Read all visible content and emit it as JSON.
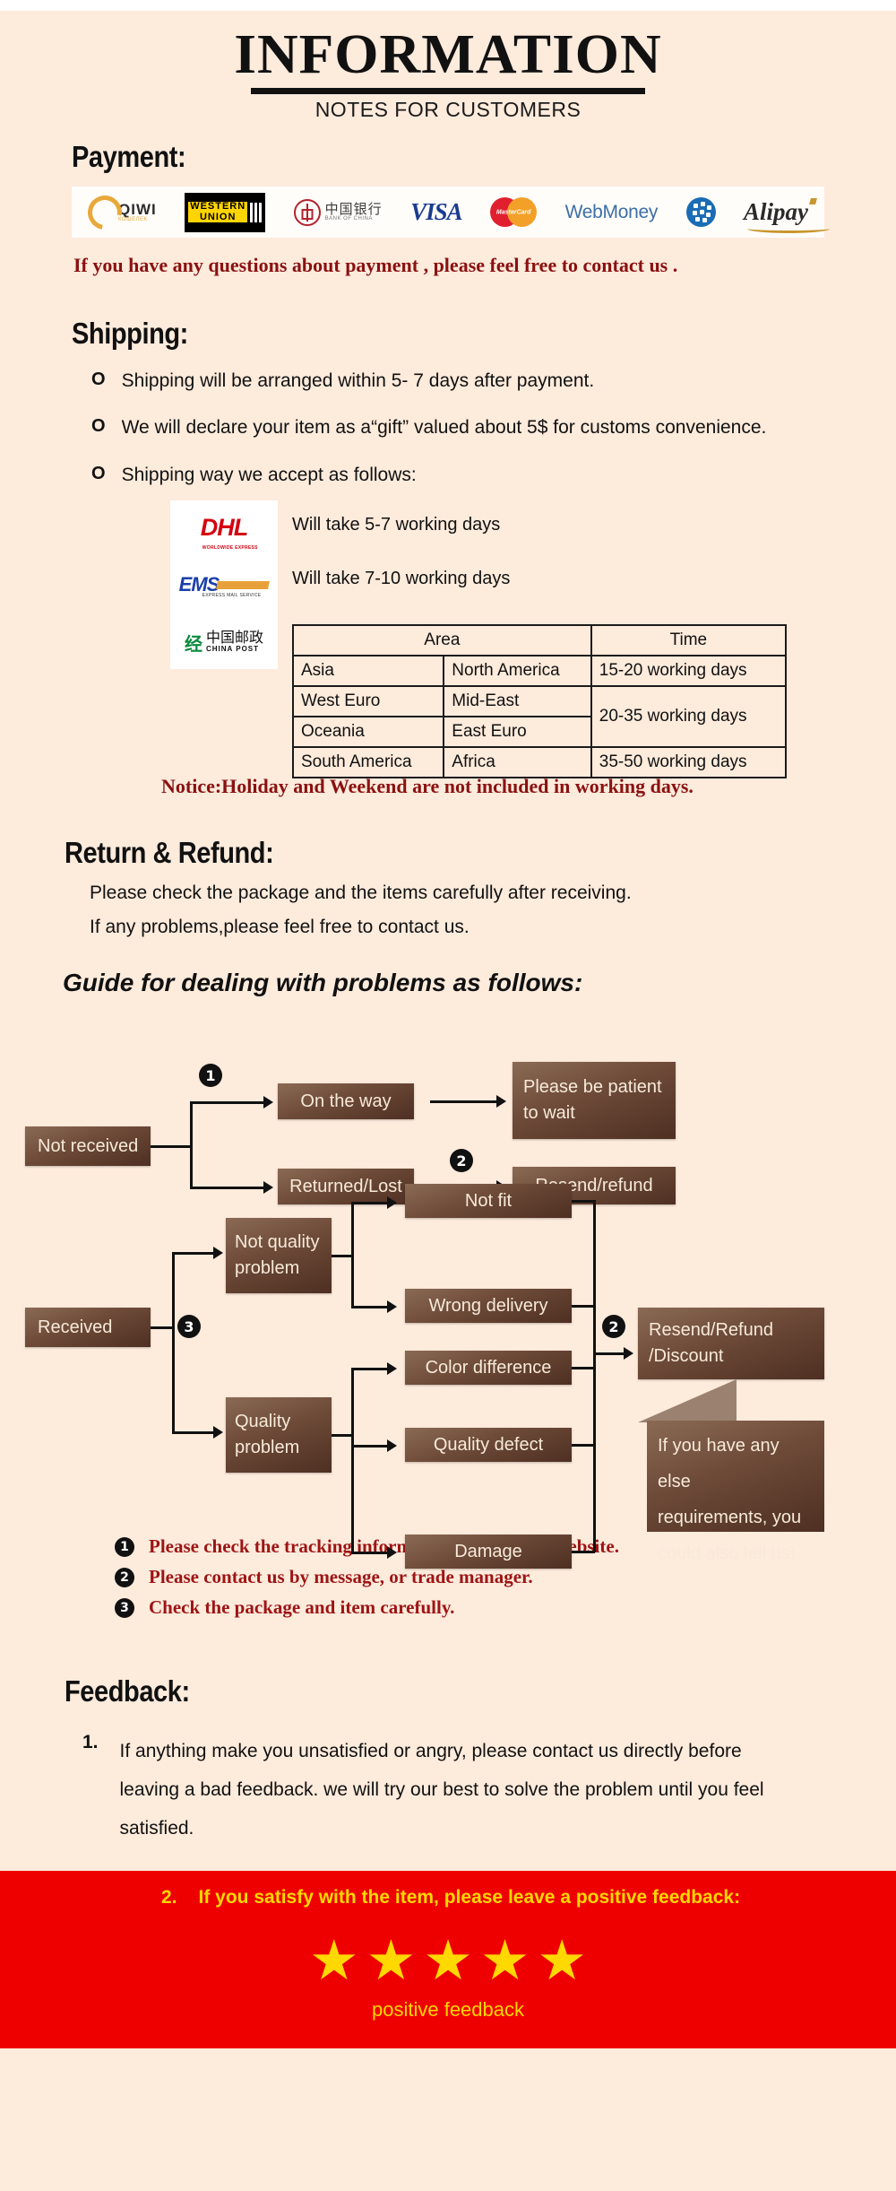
{
  "header": {
    "title": "INFORMATION",
    "subtitle": "NOTES FOR CUSTOMERS"
  },
  "payment": {
    "heading": "Payment:",
    "logos": [
      {
        "name": "qiwi-logo",
        "primary": "QIWI",
        "secondary": "КОШЕЛЕК"
      },
      {
        "name": "western-union-logo",
        "line1": "WESTERN",
        "line2": "UNION"
      },
      {
        "name": "bank-of-china-logo",
        "chinese": "中国银行",
        "roman": "BANK OF CHINA"
      },
      {
        "name": "visa-logo",
        "primary": "VISA"
      },
      {
        "name": "mastercard-logo",
        "primary": "MasterCard"
      },
      {
        "name": "webmoney-logo",
        "primary": "WebMoney"
      },
      {
        "name": "alipay-logo",
        "primary": "Alipay"
      }
    ],
    "note": "If you have any questions about payment , please feel free to contact us ."
  },
  "shipping": {
    "heading": "Shipping:",
    "bullets": [
      "Shipping will be arranged within  5- 7  days after payment.",
      "We will declare your item as a“gift” valued about 5$ for customs convenience.",
      "Shipping way we accept as follows:"
    ],
    "bullet_marker": "O",
    "carriers": [
      {
        "name": "dhl-logo",
        "label": "DHL",
        "sub": "WORLDWIDE EXPRESS",
        "time": "Will take 5-7 working days"
      },
      {
        "name": "ems-logo",
        "label": "EMS",
        "sub": "EXPRESS MAIL SERVICE",
        "time": "Will take 7-10 working days"
      },
      {
        "name": "china-post-logo",
        "chinese": "中国邮政",
        "roman": "CHINA POST",
        "time": ""
      }
    ],
    "table": {
      "headers": [
        "Area",
        "Time"
      ],
      "rows": [
        {
          "area1": "Asia",
          "area2": "North America",
          "time": "15-20 working days",
          "time_rowspan": 1
        },
        {
          "area1": "West Euro",
          "area2": "Mid-East",
          "time": "20-35 working days",
          "time_rowspan": 2
        },
        {
          "area1": "Oceania",
          "area2": "East Euro",
          "time": null,
          "time_rowspan": 0
        },
        {
          "area1": "South America",
          "area2": "Africa",
          "time": "35-50 working days",
          "time_rowspan": 1
        }
      ]
    },
    "notice": "Notice:Holiday and Weekend are not included in working days."
  },
  "returns": {
    "heading": "Return & Refund:",
    "lines": [
      "Please check the package and the items carefully after receiving.",
      "If any problems,please feel free to contact us."
    ],
    "guide_title": "Guide for dealing with problems as follows:"
  },
  "flow": {
    "not_received": "Not received",
    "on_the_way": "On the way",
    "returned_lost": "Returned/Lost",
    "please_be_patient": "Please be patient\nto wait",
    "please_be_patient_l1": "Please be patient",
    "please_be_patient_l2": "to wait",
    "resend_refund": "Resend/refund",
    "received": "Received",
    "not_quality_problem_l1": "Not quality",
    "not_quality_problem_l2": "problem",
    "quality_problem_l1": "Quality",
    "quality_problem_l2": "problem",
    "not_fit": "Not fit",
    "wrong_delivery": "Wrong delivery",
    "color_difference": "Color difference",
    "quality_defect": "Quality defect",
    "damage": "Damage",
    "resend_refund_discount_l1": "Resend/Refund",
    "resend_refund_discount_l2": "/Discount",
    "callout_l1": "If you have any else",
    "callout_l2": "requirements, you",
    "callout_l3": "could also tell us!",
    "badge1": "1",
    "badge2": "2",
    "badge2b": "2",
    "badge3": "3"
  },
  "notes": [
    {
      "num": "1",
      "text": "Please check the tracking information on tracking website."
    },
    {
      "num": "2",
      "text": "Please contact us by message, or trade manager."
    },
    {
      "num": "3",
      "text": "Check the package and item carefully."
    }
  ],
  "feedback": {
    "heading": "Feedback:",
    "item1_index": "1.",
    "item1_text": "If anything make you unsatisfied or angry, please contact us directly before leaving a bad feedback. we will try our best to solve the problem until  you feel satisfied.",
    "item2_index": "2.",
    "item2_text": "If you satisfy with the item, please leave a positive feedback:",
    "stars": "★★★★★",
    "star_glyph": "★",
    "star_count": 5,
    "caption": "positive feedback"
  },
  "colors": {
    "background": "#fdebdc",
    "red_note": "#8a1111",
    "node_brown": "#6d4a38",
    "footer_red": "#ee0000",
    "star_yellow": "#ffd800"
  }
}
